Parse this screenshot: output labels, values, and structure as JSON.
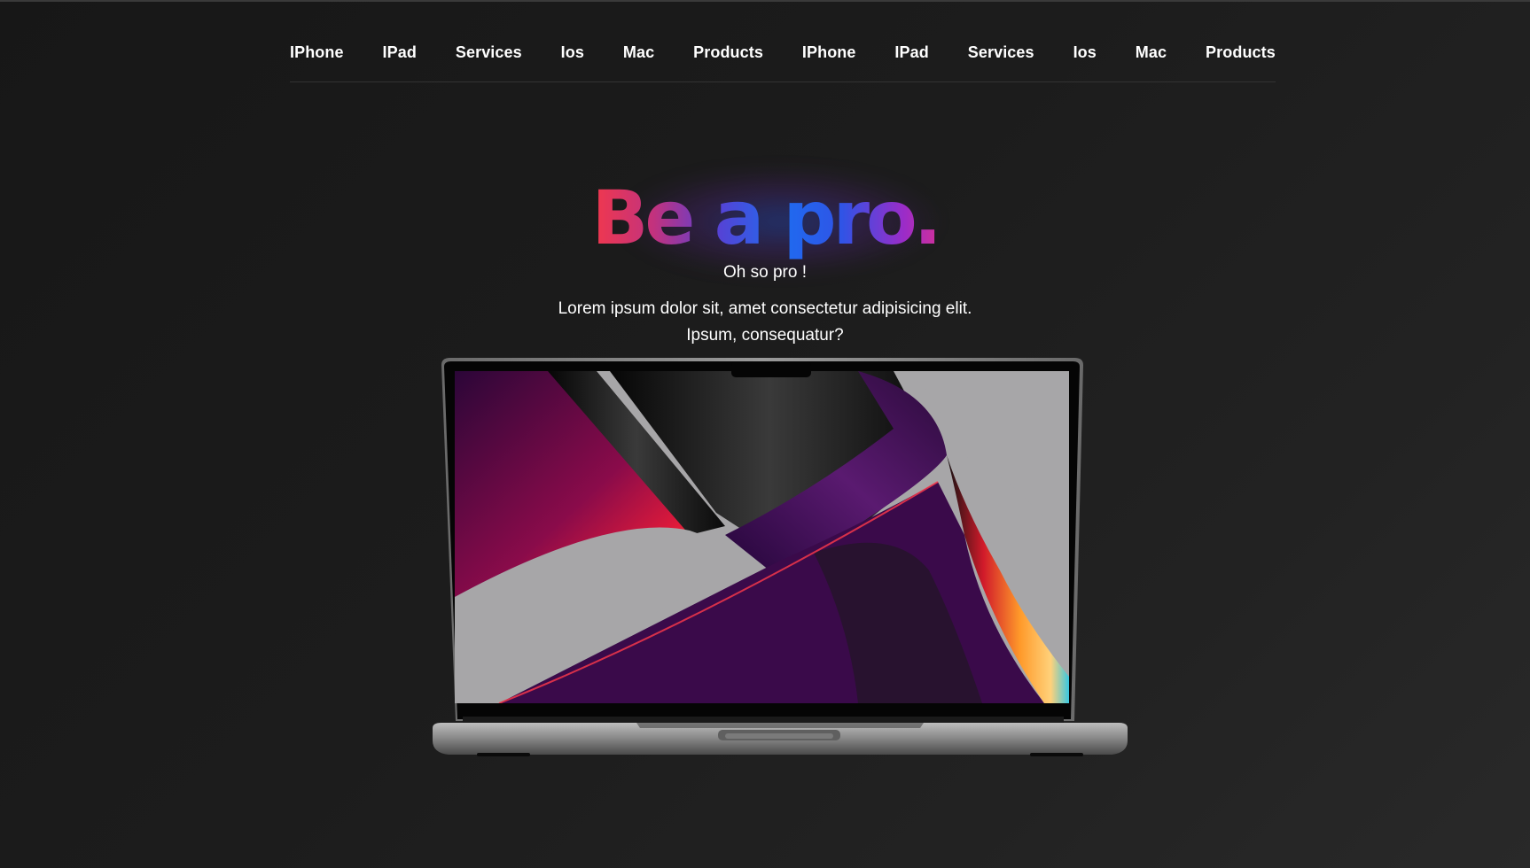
{
  "nav": {
    "items": [
      {
        "label": "IPhone"
      },
      {
        "label": "IPad"
      },
      {
        "label": "Services"
      },
      {
        "label": "Ios"
      },
      {
        "label": "Mac"
      },
      {
        "label": "Products"
      },
      {
        "label": "IPhone"
      },
      {
        "label": "IPad"
      },
      {
        "label": "Services"
      },
      {
        "label": "Ios"
      },
      {
        "label": "Mac"
      },
      {
        "label": "Products"
      }
    ]
  },
  "hero": {
    "title": "Be a pro.",
    "subtitle": "Oh so pro !",
    "description": "Lorem ipsum dolor sit, amet consectetur adipisicing elit. Ipsum, consequatur?"
  },
  "colors": {
    "background": "#1c1c1c",
    "text": "#ffffff",
    "title_gradient_start": "#f2384c",
    "title_gradient_mid": "#1f6bf0",
    "title_gradient_end": "#d0309a"
  }
}
